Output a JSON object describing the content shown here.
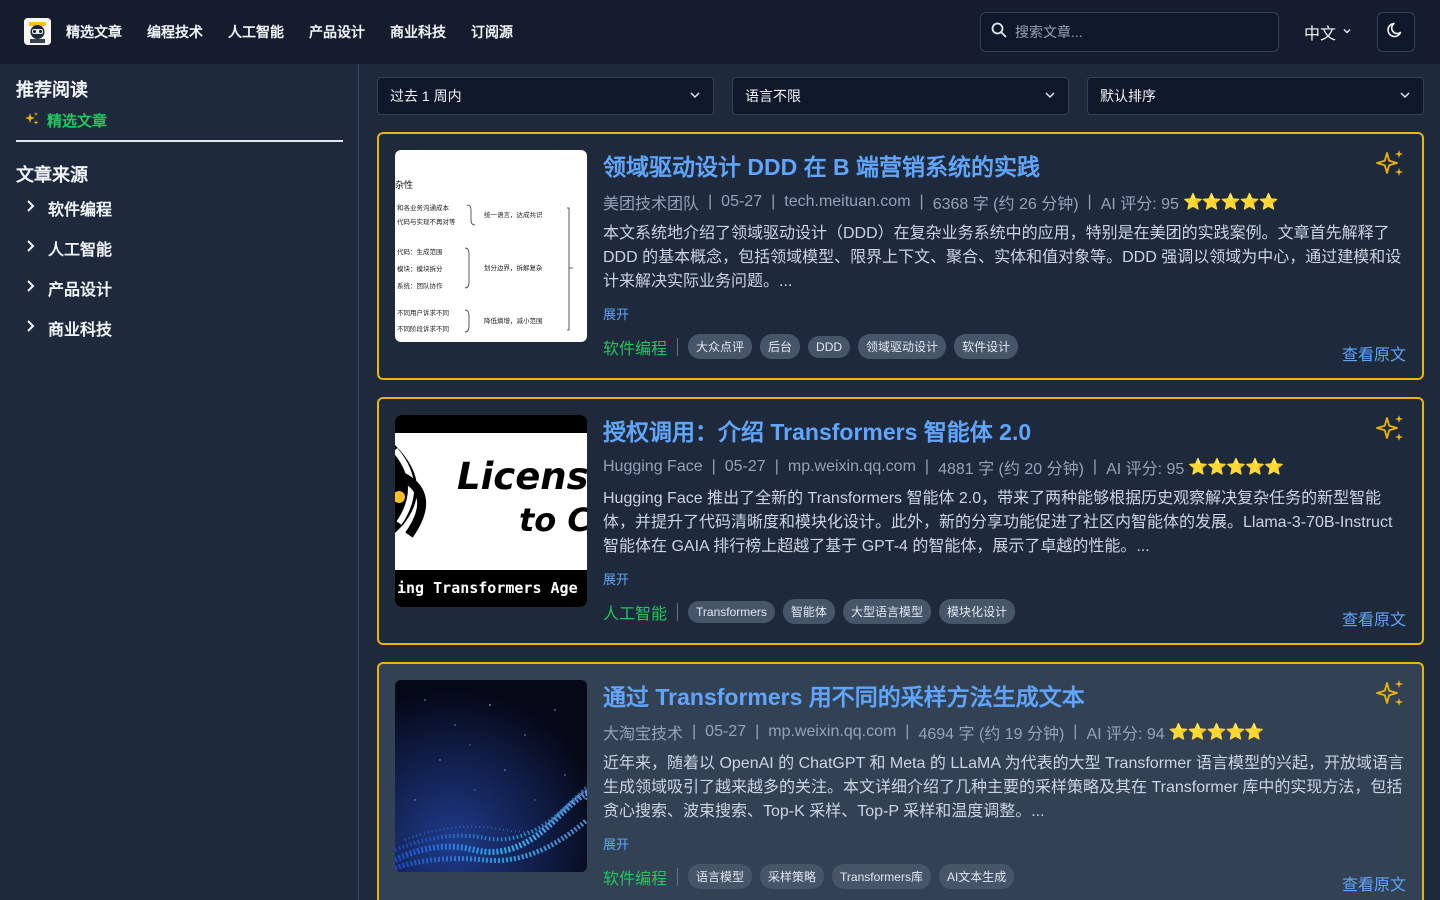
{
  "nav": {
    "links": [
      "精选文章",
      "编程技术",
      "人工智能",
      "产品设计",
      "商业科技",
      "订阅源"
    ],
    "search_placeholder": "搜索文章...",
    "language": "中文"
  },
  "sidebar": {
    "recommended_heading": "推荐阅读",
    "featured_label": "精选文章",
    "sources_heading": "文章来源",
    "sources": [
      "软件编程",
      "人工智能",
      "产品设计",
      "商业科技"
    ]
  },
  "filters": {
    "time": "过去 1 周内",
    "language": "语言不限",
    "sort": "默认排序"
  },
  "articles": [
    {
      "title": "领域驱动设计 DDD 在 B 端营销系统的实践",
      "source": "美团技术团队",
      "date": "05-27",
      "domain": "tech.meituan.com",
      "length": "6368 字 (约 26 分钟)",
      "score": "AI 评分: 95",
      "stars": "⭐⭐⭐⭐⭐",
      "summary": "本文系统地介绍了领域驱动设计（DDD）在复杂业务系统中的应用，特别是在美团的实践案例。文章首先解释了 DDD 的基本概念，包括领域模型、限界上下文、聚合、实体和值对象等。DDD 强调以领域为中心，通过建模和设计来解决实际业务问题。...",
      "expand": "展开",
      "category": "软件编程",
      "tags": [
        "大众点评",
        "后台",
        "DDD",
        "领域驱动设计",
        "软件设计"
      ],
      "view": "查看原文",
      "thumb_text": {
        "top": "杂性",
        "a1": "和各业务沟通成本",
        "a2": "代码与实现不再对等",
        "a3": "统一语言，达成共识",
        "b1": "代码：生成范围",
        "b2": "模块：模块拆分",
        "b3": "系统：团队协作",
        "b4": "划分边界，拆解复杂",
        "c1": "不同用户诉求不同",
        "c2": "不同阶段诉求不同",
        "c3": "降低熵增，减小范围"
      }
    },
    {
      "title": "授权调用：介绍 Transformers 智能体 2.0",
      "source": "Hugging Face",
      "date": "05-27",
      "domain": "mp.weixin.qq.com",
      "length": "4881 字 (约 20 分钟)",
      "score": "AI 评分: 95",
      "stars": "⭐⭐⭐⭐⭐",
      "summary": "Hugging Face 推出了全新的 Transformers 智能体 2.0，带来了两种能够根据历史观察解决复杂任务的新型智能体，并提升了代码清晰度和模块化设计。此外，新的分享功能促进了社区内智能体的发展。Llama-3-70B-Instruct 智能体在 GAIA 排行榜上超越了基于 GPT-4 的智能体，展示了卓越的性能。...",
      "expand": "展开",
      "category": "人工智能",
      "tags": [
        "Transformers",
        "智能体",
        "大型语言模型",
        "模块化设计"
      ],
      "view": "查看原文",
      "thumb_text": {
        "line1": "Licens",
        "line2": "to C",
        "bottom": "ing Transformers Age"
      }
    },
    {
      "title": "通过 Transformers 用不同的采样方法生成文本",
      "source": "大淘宝技术",
      "date": "05-27",
      "domain": "mp.weixin.qq.com",
      "length": "4694 字 (约 19 分钟)",
      "score": "AI 评分: 94",
      "stars": "⭐⭐⭐⭐⭐",
      "summary": "近年来，随着以 OpenAI 的 ChatGPT 和 Meta 的 LLaMA 为代表的大型 Transformer 语言模型的兴起，开放域语言生成领域吸引了越来越多的关注。本文详细介绍了几种主要的采样策略及其在 Transformer 库中的实现方法，包括贪心搜索、波束搜索、Top-K 采样、Top-P 采样和温度调整。...",
      "expand": "展开",
      "category": "软件编程",
      "tags": [
        "语言模型",
        "采样策略",
        "Transformers库",
        "AI文本生成"
      ],
      "view": "查看原文"
    }
  ]
}
